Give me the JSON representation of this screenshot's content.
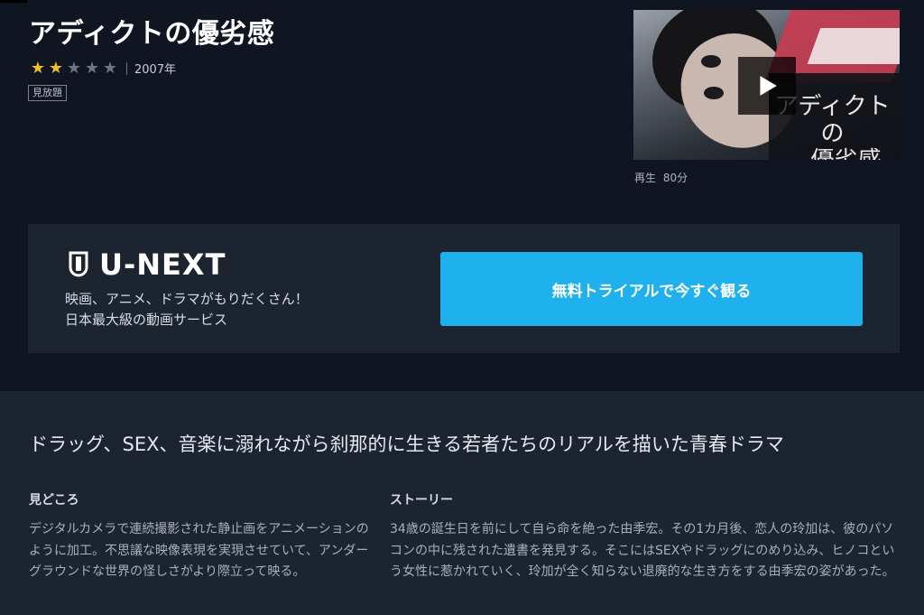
{
  "title": "アディクトの優劣感",
  "rating": {
    "value": 2,
    "max": 5,
    "filled_color": "#f3c11b",
    "empty_color": "#6e7480"
  },
  "year": "2007年",
  "badge": "見放題",
  "thumbnail": {
    "title_line1": "アディクトの",
    "title_line2": "優劣感",
    "icon": "play-icon"
  },
  "play_info": {
    "label": "再生",
    "duration": "80分"
  },
  "promo": {
    "logo_text": "U-NEXT",
    "logo_icon": "u-next-shield-icon",
    "line1": "映画、アニメ、ドラマがもりだくさん！",
    "line2": "日本最大級の動画サービス",
    "cta_label": "無料トライアルで今すぐ観る",
    "cta_color": "#1eb1ee"
  },
  "tagline": "ドラッグ、SEX、音楽に溺れながら刹那的に生きる若者たちのリアルを描いた青春ドラマ",
  "highlights": {
    "heading": "見どころ",
    "body": "デジタルカメラで連続撮影された静止画をアニメーションのように加工。不思議な映像表現を実現させていて、アンダーグラウンドな世界の怪しさがより際立って映る。"
  },
  "story": {
    "heading": "ストーリー",
    "body": "34歳の誕生日を前にして自ら命を絶った由季宏。その1カ月後、恋人の玲加は、彼のパソコンの中に残された遺書を発見する。そこにはSEXやドラッグにのめり込み、ヒノコという女性に惹かれていく、玲加が全く知らない退廃的な生き方をする由季宏の姿があった。"
  }
}
